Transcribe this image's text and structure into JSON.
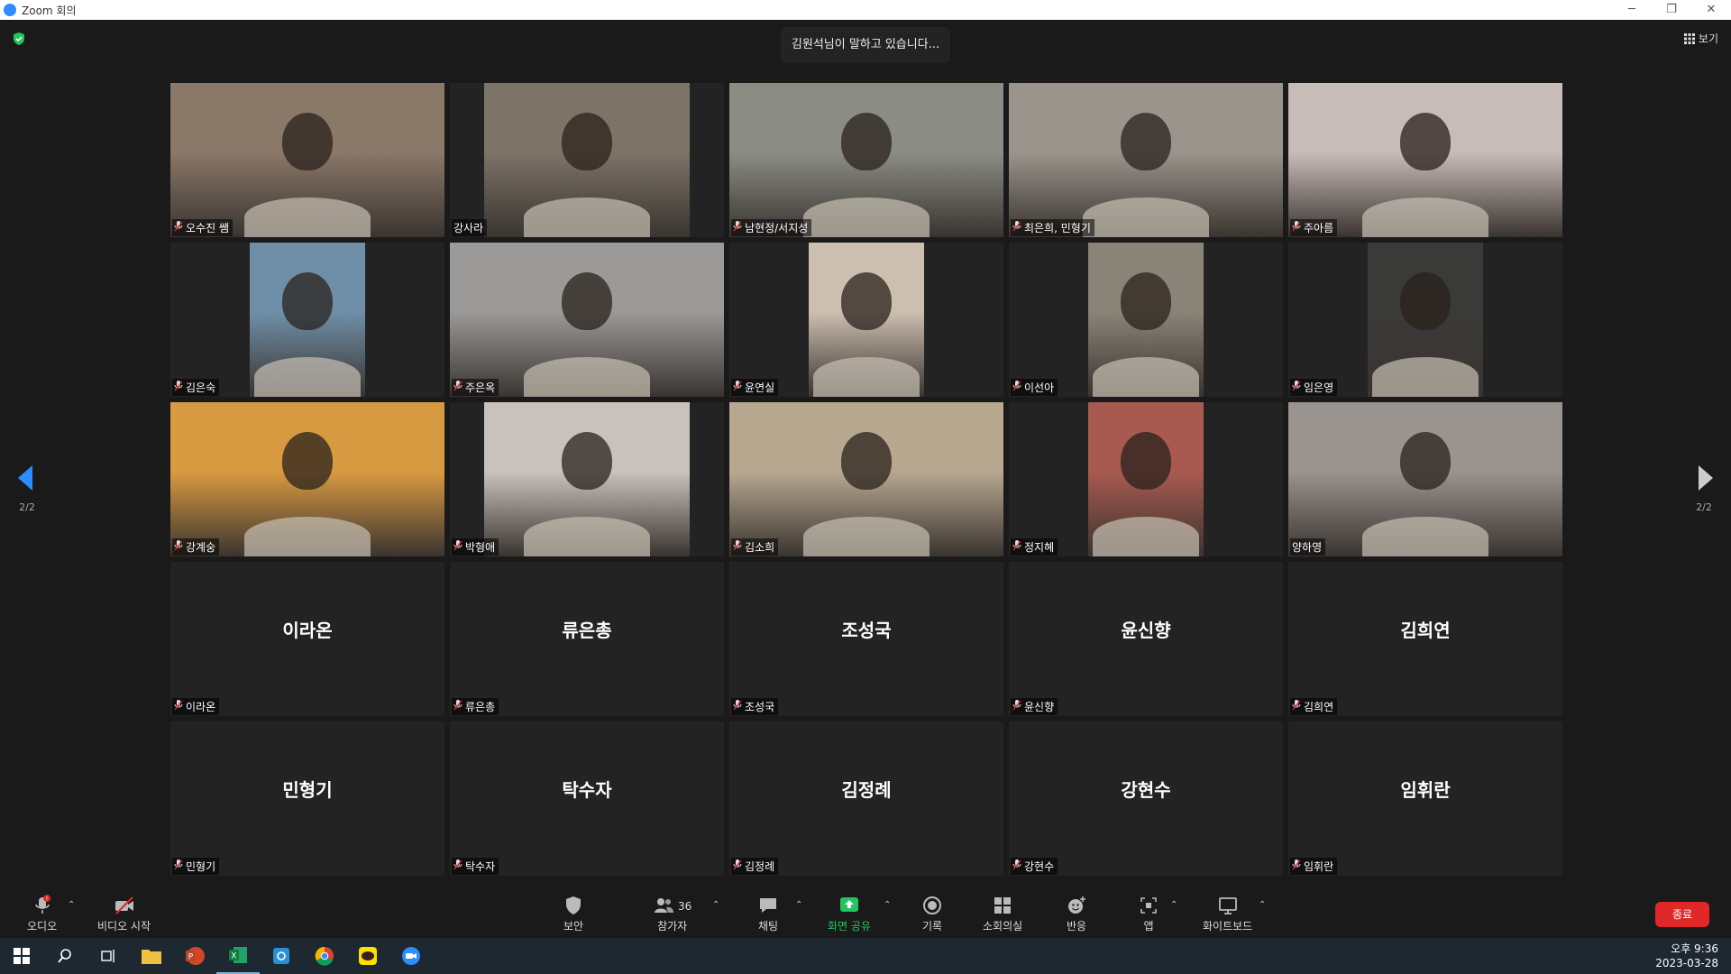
{
  "window": {
    "title": "Zoom 회의"
  },
  "top": {
    "speaking": "김원석님이 말하고 있습니다...",
    "view_label": "보기"
  },
  "pager": {
    "left": "2/2",
    "right": "2/2"
  },
  "tiles": [
    {
      "name": "오수진 쌤",
      "muted": true,
      "video": true,
      "bg": "#8a7868",
      "w": 304
    },
    {
      "name": "강사라",
      "muted": false,
      "video": true,
      "bg": "#7d7468",
      "w": 228
    },
    {
      "name": "남현정/서지성",
      "muted": true,
      "video": true,
      "bg": "#8b8d84",
      "w": 304
    },
    {
      "name": "최은희, 민형기",
      "muted": true,
      "video": true,
      "bg": "#9a948c",
      "w": 304
    },
    {
      "name": "주아름",
      "muted": true,
      "video": true,
      "bg": "#c8bcb8",
      "w": 304
    },
    {
      "name": "김은숙",
      "muted": true,
      "video": true,
      "bg": "#6f8fa8",
      "w": 128
    },
    {
      "name": "주은옥",
      "muted": true,
      "video": true,
      "bg": "#9b9a98",
      "w": 304
    },
    {
      "name": "윤연실",
      "muted": true,
      "video": true,
      "bg": "#cdbfb0",
      "w": 128
    },
    {
      "name": "이선아",
      "muted": true,
      "video": true,
      "bg": "#8a8478",
      "w": 128
    },
    {
      "name": "임은영",
      "muted": true,
      "video": true,
      "bg": "#3a3a38",
      "w": 128
    },
    {
      "name": "강계숭",
      "muted": true,
      "video": true,
      "bg": "#d89a40",
      "w": 304
    },
    {
      "name": "박형애",
      "muted": true,
      "video": true,
      "bg": "#c9c2bc",
      "w": 228
    },
    {
      "name": "김소희",
      "muted": true,
      "video": true,
      "bg": "#b8a890",
      "w": 304
    },
    {
      "name": "정지혜",
      "muted": true,
      "video": true,
      "bg": "#a85a50",
      "w": 128
    },
    {
      "name": "양하영",
      "muted": false,
      "video": true,
      "bg": "#9a9490",
      "w": 304
    },
    {
      "name": "이라온",
      "muted": true,
      "video": false
    },
    {
      "name": "류은총",
      "muted": true,
      "video": false
    },
    {
      "name": "조성국",
      "muted": true,
      "video": false
    },
    {
      "name": "윤신향",
      "muted": true,
      "video": false
    },
    {
      "name": "김희연",
      "muted": true,
      "video": false
    },
    {
      "name": "민형기",
      "muted": true,
      "video": false
    },
    {
      "name": "탁수자",
      "muted": true,
      "video": false
    },
    {
      "name": "김정례",
      "muted": true,
      "video": false
    },
    {
      "name": "강현수",
      "muted": true,
      "video": false
    },
    {
      "name": "임휘란",
      "muted": true,
      "video": false
    }
  ],
  "toolbar": {
    "audio": "오디오",
    "video": "비디오 시작",
    "security": "보안",
    "participants": "참가자",
    "participants_count": "36",
    "chat": "채팅",
    "share": "화면 공유",
    "record": "기록",
    "breakout": "소회의실",
    "reactions": "반응",
    "apps": "앱",
    "whiteboard": "화이트보드",
    "end": "종료"
  },
  "clock": {
    "time": "오후 9:36",
    "date": "2023-03-28"
  },
  "colors": {
    "share": "#22c55e",
    "end": "#e02828",
    "accent": "#2d8cff"
  }
}
